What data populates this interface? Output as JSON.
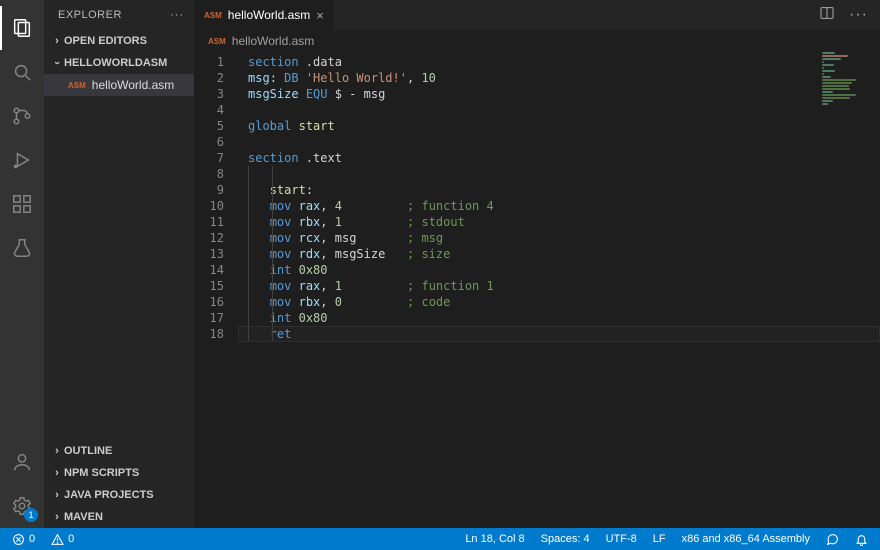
{
  "sidebar": {
    "title": "EXPLORER",
    "openEditors": "OPEN EDITORS",
    "folder": "HELLOWORLDASM",
    "file": {
      "langTag": "ASM",
      "name": "helloWorld.asm"
    },
    "outline": "OUTLINE",
    "npm": "NPM SCRIPTS",
    "java": "JAVA PROJECTS",
    "maven": "MAVEN"
  },
  "activity": {
    "settingsBadge": "1"
  },
  "tabs": {
    "file": {
      "langTag": "ASM",
      "name": "helloWorld.asm"
    }
  },
  "breadcrumb": {
    "langTag": "ASM",
    "name": "helloWorld.asm"
  },
  "code": {
    "lines": [
      [
        [
          "kw",
          "section"
        ],
        [
          "",
          " .data"
        ]
      ],
      [
        [
          "lbl",
          "msg"
        ],
        [
          "",
          ": "
        ],
        [
          "kw",
          "DB"
        ],
        [
          "",
          " "
        ],
        [
          "str",
          "'Hello World!'"
        ],
        [
          "",
          ", "
        ],
        [
          "num",
          "10"
        ]
      ],
      [
        [
          "lbl",
          "msgSize"
        ],
        [
          "",
          " "
        ],
        [
          "kw",
          "EQU"
        ],
        [
          "",
          " $ - msg"
        ]
      ],
      [],
      [
        [
          "kw",
          "global"
        ],
        [
          "",
          " "
        ],
        [
          "fn",
          "start"
        ]
      ],
      [],
      [
        [
          "kw",
          "section"
        ],
        [
          "",
          " .text"
        ]
      ],
      [],
      [
        [
          "",
          "   "
        ],
        [
          "fn",
          "start"
        ],
        [
          "",
          ":"
        ]
      ],
      [
        [
          "",
          "   "
        ],
        [
          "kw",
          "mov"
        ],
        [
          "",
          " "
        ],
        [
          "lbl",
          "rax"
        ],
        [
          "",
          ", "
        ],
        [
          "num",
          "4"
        ],
        [
          "",
          "         "
        ],
        [
          "cmt",
          "; function 4"
        ]
      ],
      [
        [
          "",
          "   "
        ],
        [
          "kw",
          "mov"
        ],
        [
          "",
          " "
        ],
        [
          "lbl",
          "rbx"
        ],
        [
          "",
          ", "
        ],
        [
          "num",
          "1"
        ],
        [
          "",
          "         "
        ],
        [
          "cmt",
          "; stdout"
        ]
      ],
      [
        [
          "",
          "   "
        ],
        [
          "kw",
          "mov"
        ],
        [
          "",
          " "
        ],
        [
          "lbl",
          "rcx"
        ],
        [
          "",
          ", msg       "
        ],
        [
          "cmt",
          "; msg"
        ]
      ],
      [
        [
          "",
          "   "
        ],
        [
          "kw",
          "mov"
        ],
        [
          "",
          " "
        ],
        [
          "lbl",
          "rdx"
        ],
        [
          "",
          ", msgSize   "
        ],
        [
          "cmt",
          "; size"
        ]
      ],
      [
        [
          "",
          "   "
        ],
        [
          "kw",
          "int"
        ],
        [
          "",
          " "
        ],
        [
          "num",
          "0x80"
        ]
      ],
      [
        [
          "",
          "   "
        ],
        [
          "kw",
          "mov"
        ],
        [
          "",
          " "
        ],
        [
          "lbl",
          "rax"
        ],
        [
          "",
          ", "
        ],
        [
          "num",
          "1"
        ],
        [
          "",
          "         "
        ],
        [
          "cmt",
          "; function 1"
        ]
      ],
      [
        [
          "",
          "   "
        ],
        [
          "kw",
          "mov"
        ],
        [
          "",
          " "
        ],
        [
          "lbl",
          "rbx"
        ],
        [
          "",
          ", "
        ],
        [
          "num",
          "0"
        ],
        [
          "",
          "         "
        ],
        [
          "cmt",
          "; code"
        ]
      ],
      [
        [
          "",
          "   "
        ],
        [
          "kw",
          "int"
        ],
        [
          "",
          " "
        ],
        [
          "num",
          "0x80"
        ]
      ],
      [
        [
          "",
          "   "
        ],
        [
          "kw",
          "ret"
        ]
      ]
    ],
    "cursorLine": 18
  },
  "status": {
    "errors": "0",
    "warnings": "0",
    "lncol": "Ln 18, Col 8",
    "spaces": "Spaces: 4",
    "encoding": "UTF-8",
    "eol": "LF",
    "lang": "x86 and x86_64 Assembly"
  }
}
